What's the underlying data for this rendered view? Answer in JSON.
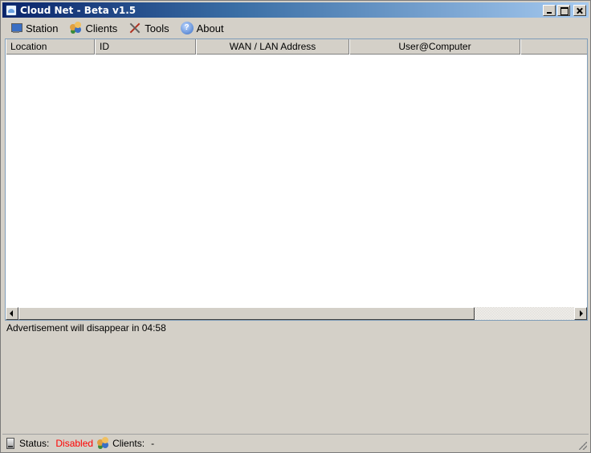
{
  "window": {
    "title": "Cloud Net - Beta v1.5"
  },
  "menu": {
    "items": [
      {
        "label": "Station",
        "icon": "monitor-icon"
      },
      {
        "label": "Clients",
        "icon": "users-icon"
      },
      {
        "label": "Tools",
        "icon": "tools-icon"
      },
      {
        "label": "About",
        "icon": "help-icon"
      }
    ]
  },
  "list": {
    "columns": [
      "Location",
      "ID",
      "WAN / LAN Address",
      "User@Computer",
      ""
    ],
    "rows": []
  },
  "ad": {
    "text": "Advertisement will disappear in 04:58"
  },
  "status": {
    "status_label": "Status:",
    "status_value": "Disabled",
    "clients_label": "Clients:",
    "clients_value": "-",
    "status_color": "#ff0000"
  }
}
